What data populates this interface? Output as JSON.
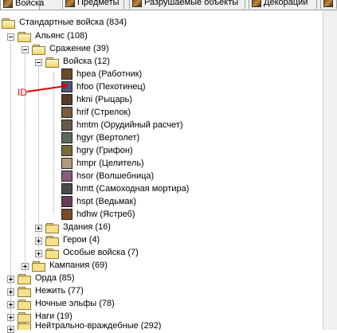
{
  "tabs": [
    {
      "label": "Войска",
      "active": true
    },
    {
      "label": "Предметы",
      "active": false
    },
    {
      "label": "Разрушаемые объекты",
      "active": false
    },
    {
      "label": "Декорации",
      "active": false
    }
  ],
  "tree": {
    "root": "Стандартные войска (834)",
    "alliance": "Альянс (108)",
    "melee": "Сражение (39)",
    "units": "Войска (12)",
    "unit_items": [
      {
        "label": "hpea (Работник)",
        "icon": "peasant-icon",
        "color": "#6a4b2a"
      },
      {
        "label": "hfoo (Пехотинец)",
        "icon": "footman-icon",
        "color": "#4a5a7a"
      },
      {
        "label": "hkni (Рыцарь)",
        "icon": "knight-icon",
        "color": "#5a3a2a"
      },
      {
        "label": "hrif (Стрелок)",
        "icon": "rifleman-icon",
        "color": "#7a5a3a"
      },
      {
        "label": "hmtm (Орудийный расчет)",
        "icon": "mortar-team-icon",
        "color": "#6a5a4a"
      },
      {
        "label": "hgyr (Вертолет)",
        "icon": "gyrocopter-icon",
        "color": "#5a6a5a"
      },
      {
        "label": "hgry (Грифон)",
        "icon": "gryphon-icon",
        "color": "#7a6a3a"
      },
      {
        "label": "hmpr (Целитель)",
        "icon": "priest-icon",
        "color": "#b09a7a"
      },
      {
        "label": "hsor (Волшебница)",
        "icon": "sorceress-icon",
        "color": "#8a5a7a"
      },
      {
        "label": "hmtt (Самоходная мортира)",
        "icon": "siege-engine-icon",
        "color": "#4a4a4a"
      },
      {
        "label": "hspt (Ведьмак)",
        "icon": "spell-breaker-icon",
        "color": "#6a3a5a"
      },
      {
        "label": "hdhw (Ястреб)",
        "icon": "dragonhawk-icon",
        "color": "#7a4a2a"
      }
    ],
    "buildings": "Здания (16)",
    "heroes": "Герои (4)",
    "special_units": "Особые войска (7)",
    "campaign": "Кампания (69)",
    "races": [
      {
        "label": "Орда (85)"
      },
      {
        "label": "Нежить (77)"
      },
      {
        "label": "Ночные эльфы (78)"
      },
      {
        "label": "Наги (19)"
      },
      {
        "label": "Нейтрально-враждебные (292)"
      }
    ]
  },
  "annotation": {
    "label": "ID",
    "color": "#e00000"
  }
}
